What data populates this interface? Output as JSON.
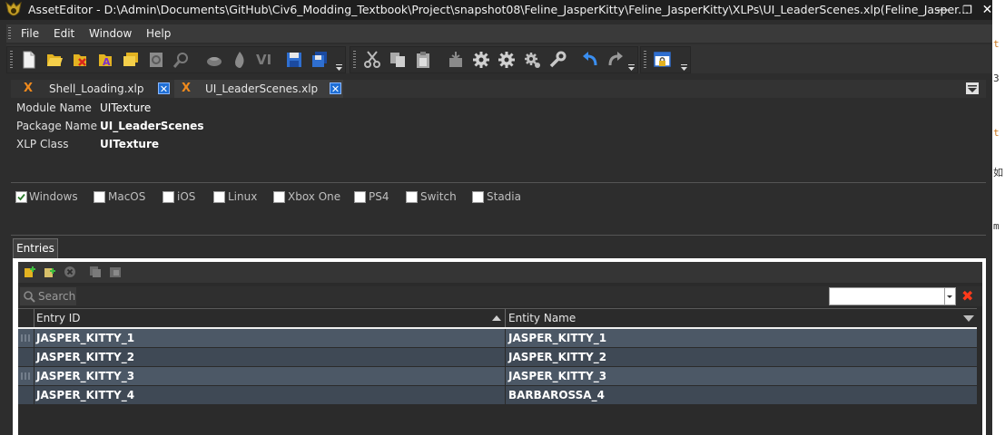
{
  "window": {
    "app_name": "AssetEditor",
    "title": "AssetEditor  -  D:\\Admin\\Documents\\GitHub\\Civ6_Modding_Textbook\\Project\\snapshot08\\Feline_JasperKitty\\Feline_JasperKitty\\XLPs\\UI_LeaderScenes.xlp(Feline_Jasper...",
    "minimize_glyph": "—",
    "restore_glyph": "❐",
    "close_glyph": "✕"
  },
  "menu": {
    "items": [
      "File",
      "Edit",
      "Window",
      "Help"
    ]
  },
  "toolbar": {
    "icons": [
      "new-file-icon",
      "open-folder-icon",
      "delete-file-icon",
      "font-icon",
      "folder-stack-icon",
      "refresh-icon",
      "zoom-icon",
      "bowl-icon",
      "flame-icon",
      "vi-icon",
      "save-icon",
      "save-all-icon",
      "cut-icon",
      "copy-icon",
      "paste-icon",
      "package-icon",
      "gear-icon",
      "gear-icon",
      "gear-cog-icon",
      "wrench-icon",
      "undo-icon",
      "redo-icon",
      "window-lock-icon"
    ],
    "vi_label": "VI"
  },
  "doc_tabs": [
    {
      "label": "Shell_Loading.xlp",
      "active": false
    },
    {
      "label": "UI_LeaderScenes.xlp",
      "active": true
    }
  ],
  "tab_close_glyph": "✕",
  "tab_icon_glyph": "X",
  "properties": {
    "module_name_label": "Module Name",
    "module_name_value": "UITexture",
    "package_name_label": "Package Name",
    "package_name_value": "UI_LeaderScenes",
    "xlp_class_label": "XLP Class",
    "xlp_class_value": "UITexture"
  },
  "platforms": [
    {
      "label": "Windows",
      "checked": true
    },
    {
      "label": "MacOS",
      "checked": false
    },
    {
      "label": "iOS",
      "checked": false
    },
    {
      "label": "Linux",
      "checked": false
    },
    {
      "label": "Xbox One",
      "checked": false
    },
    {
      "label": "PS4",
      "checked": false
    },
    {
      "label": "Switch",
      "checked": false
    },
    {
      "label": "Stadia",
      "checked": false
    }
  ],
  "entries": {
    "tab_label": "Entries",
    "search_label": "Search",
    "search_value": "",
    "clear_glyph": "✖",
    "columns": [
      "Entry ID",
      "Entity Name"
    ],
    "rows": [
      {
        "entry_id": "JASPER_KITTY_1",
        "entity_name": "JASPER_KITTY_1"
      },
      {
        "entry_id": "JASPER_KITTY_2",
        "entity_name": "JASPER_KITTY_2"
      },
      {
        "entry_id": "JASPER_KITTY_3",
        "entity_name": "JASPER_KITTY_3"
      },
      {
        "entry_id": "JASPER_KITTY_4",
        "entity_name": "BARBAROSSA_4"
      }
    ]
  },
  "right_edge_fragments": [
    "t",
    "3",
    "t",
    "如",
    "m"
  ],
  "colors": {
    "accent_blue": "#1f6fd6",
    "tab_x_orange": "#f08a1d",
    "row_a": "#4c5866",
    "row_b": "#3f4955",
    "clear_red": "#ff3a1a"
  }
}
